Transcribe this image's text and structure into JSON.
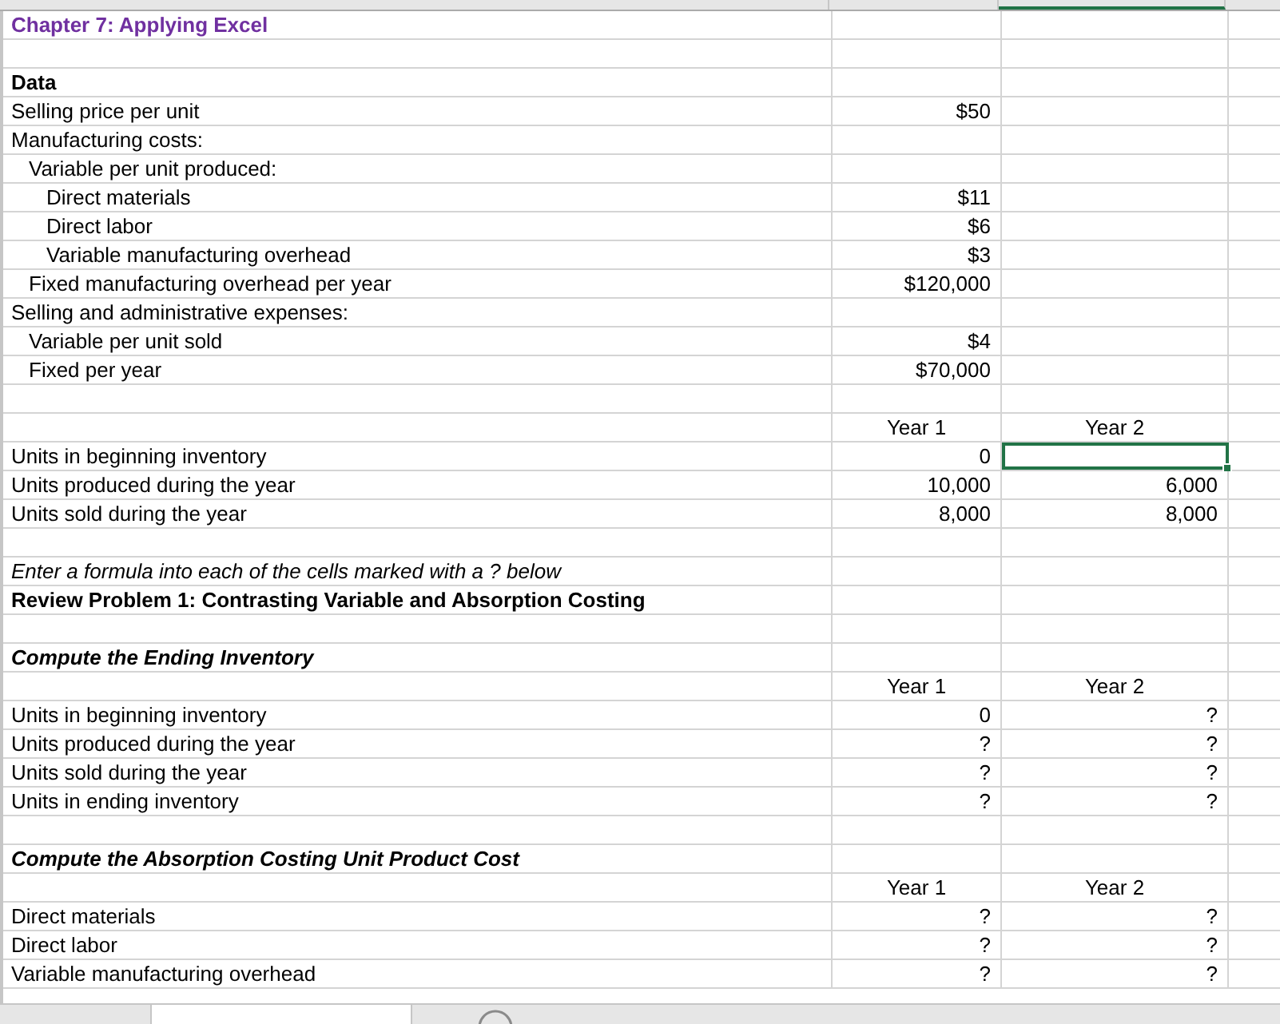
{
  "rows": [
    {
      "kind": "title",
      "label": "Chapter 7: Applying Excel",
      "selected": false
    },
    {
      "kind": "blank",
      "selected": false
    },
    {
      "kind": "heading",
      "label": "Data",
      "selected": false
    },
    {
      "kind": "row",
      "label": "Selling price per unit",
      "b": "$50",
      "selected": false
    },
    {
      "kind": "row",
      "label": "Manufacturing costs:",
      "selected": false
    },
    {
      "kind": "indent-row",
      "label": "Variable per unit produced:",
      "selected": false
    },
    {
      "kind": "indent2-row",
      "label": "Direct materials",
      "b": "$11",
      "selected": false
    },
    {
      "kind": "indent2-row",
      "label": "Direct labor",
      "b": "$6",
      "selected": false
    },
    {
      "kind": "indent2-row",
      "label": "Variable manufacturing overhead",
      "b": "$3",
      "selected": false
    },
    {
      "kind": "indent-row",
      "label": "Fixed manufacturing overhead per year",
      "b": "$120,000",
      "selected": false
    },
    {
      "kind": "row",
      "label": "Selling and administrative expenses:",
      "selected": false
    },
    {
      "kind": "indent-row",
      "label": "Variable per unit sold",
      "b": "$4",
      "selected": false
    },
    {
      "kind": "indent-row",
      "label": "Fixed per year",
      "b": "$70,000",
      "selected": false
    },
    {
      "kind": "blank",
      "selected": false
    },
    {
      "kind": "header",
      "b": "Year 1",
      "c": "Year 2",
      "selected": false
    },
    {
      "kind": "row",
      "label": "Units in beginning inventory",
      "b": "0",
      "selected": true
    },
    {
      "kind": "row",
      "label": "Units produced during the year",
      "b": "10,000",
      "c": "6,000",
      "selected": false
    },
    {
      "kind": "row",
      "label": "Units sold during the year",
      "b": "8,000",
      "c": "8,000",
      "selected": false
    },
    {
      "kind": "blank",
      "selected": false
    },
    {
      "kind": "note",
      "label": "Enter a formula into each of the cells marked with a ? below",
      "selected": false
    },
    {
      "kind": "heading",
      "label": "Review Problem 1: Contrasting Variable and Absorption Costing",
      "selected": false
    },
    {
      "kind": "blank",
      "selected": false
    },
    {
      "kind": "section",
      "label": "Compute the Ending Inventory",
      "selected": false
    },
    {
      "kind": "header",
      "b": "Year 1",
      "c": "Year 2",
      "selected": false
    },
    {
      "kind": "row",
      "label": "Units in beginning inventory",
      "b": "0",
      "c": "?",
      "selected": false
    },
    {
      "kind": "row",
      "label": "Units produced during the year",
      "b": "?",
      "c": "?",
      "selected": false
    },
    {
      "kind": "row",
      "label": "Units sold during the year",
      "b": "?",
      "c": "?",
      "selected": false
    },
    {
      "kind": "row",
      "label": "Units in ending inventory",
      "b": "?",
      "c": "?",
      "selected": false
    },
    {
      "kind": "blank",
      "selected": false
    },
    {
      "kind": "section",
      "label": "Compute the Absorption Costing Unit Product Cost",
      "selected": false
    },
    {
      "kind": "header",
      "b": "Year 1",
      "c": "Year 2",
      "selected": false
    },
    {
      "kind": "row",
      "label": "Direct materials",
      "b": "?",
      "c": "?",
      "selected": false
    },
    {
      "kind": "row",
      "label": "Direct labor",
      "b": "?",
      "c": "?",
      "selected": false
    },
    {
      "kind": "row",
      "label": "Variable manufacturing overhead",
      "b": "?",
      "c": "?",
      "selected": false
    }
  ]
}
